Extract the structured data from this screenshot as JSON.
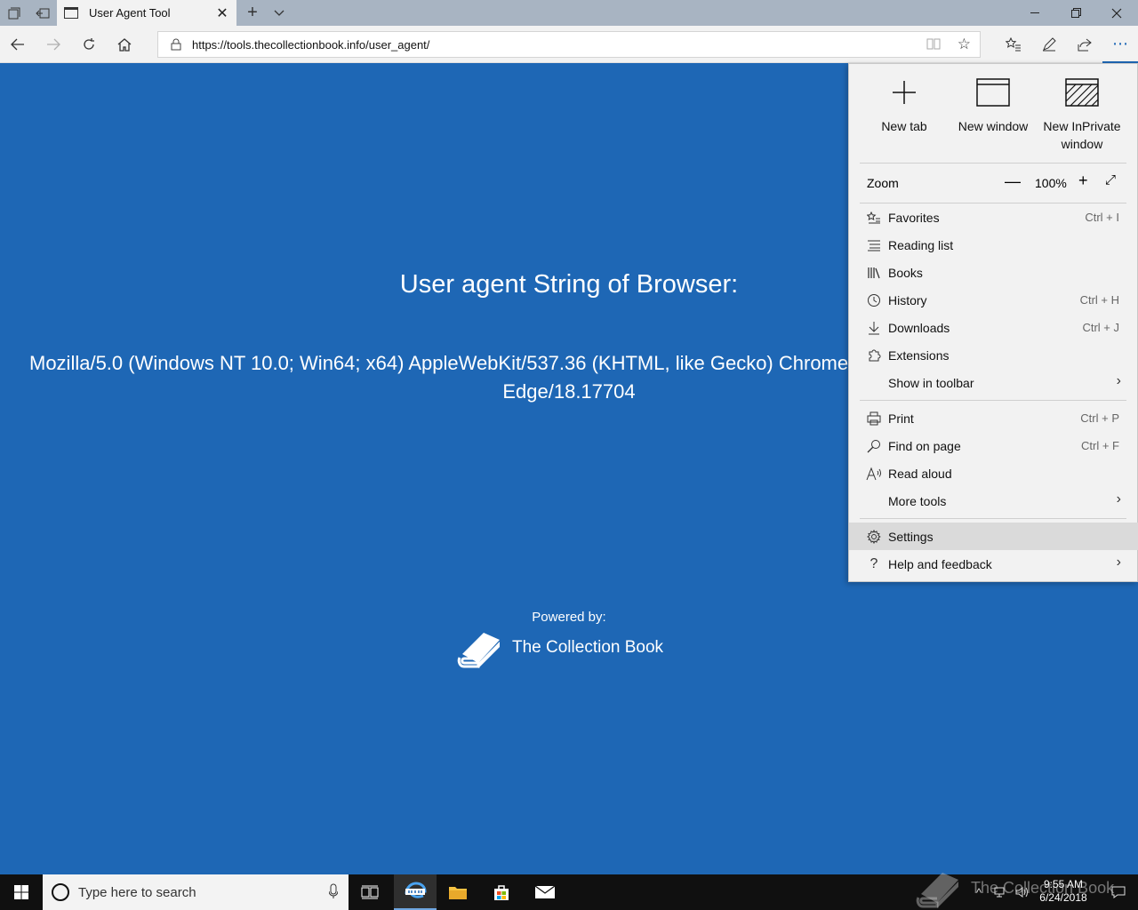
{
  "browser": {
    "tab_title": "User Agent Tool",
    "url": "https://tools.thecollectionbook.info/user_agent/",
    "accent_color": "#1e67b5"
  },
  "page": {
    "heading": "User agent String of Browser:",
    "ua_line1": "Mozilla/5.0 (Windows NT 10.0; Win64; x64) AppleWebKit/537.36 (KHTML, like Gecko) Chrome",
    "ua_line2": "Edge/18.17704",
    "powered_by": "Powered by:",
    "brand_name": "The Collection Book",
    "background_color": "#1e67b5"
  },
  "menu": {
    "tiles": [
      {
        "label": "New tab",
        "icon": "plus-icon"
      },
      {
        "label": "New window",
        "icon": "window-icon"
      },
      {
        "label": "New InPrivate window",
        "icon": "inprivate-window-icon"
      }
    ],
    "zoom": {
      "label": "Zoom",
      "minus": "—",
      "value": "100%",
      "plus": "+"
    },
    "group1": [
      {
        "label": "Favorites",
        "shortcut": "Ctrl + I",
        "icon": "favorites-icon"
      },
      {
        "label": "Reading list",
        "shortcut": "",
        "icon": "reading-list-icon"
      },
      {
        "label": "Books",
        "shortcut": "",
        "icon": "books-icon"
      },
      {
        "label": "History",
        "shortcut": "Ctrl + H",
        "icon": "history-icon"
      },
      {
        "label": "Downloads",
        "shortcut": "Ctrl + J",
        "icon": "download-icon"
      },
      {
        "label": "Extensions",
        "shortcut": "",
        "icon": "extensions-icon"
      },
      {
        "label": "Show in toolbar",
        "shortcut": "",
        "icon": ""
      }
    ],
    "group2": [
      {
        "label": "Print",
        "shortcut": "Ctrl + P",
        "icon": "print-icon"
      },
      {
        "label": "Find on page",
        "shortcut": "Ctrl + F",
        "icon": "search-icon"
      },
      {
        "label": "Read aloud",
        "shortcut": "",
        "icon": "read-aloud-icon"
      },
      {
        "label": "More tools",
        "shortcut": "",
        "icon": ""
      }
    ],
    "group3": [
      {
        "label": "Settings",
        "shortcut": "",
        "icon": "gear-icon"
      },
      {
        "label": "Help and feedback",
        "shortcut": "",
        "icon": "help-icon"
      }
    ]
  },
  "taskbar": {
    "search_placeholder": "Type here to search",
    "time": "9:55 AM",
    "date": "6/24/2018",
    "watermark": "The Collection Book"
  }
}
